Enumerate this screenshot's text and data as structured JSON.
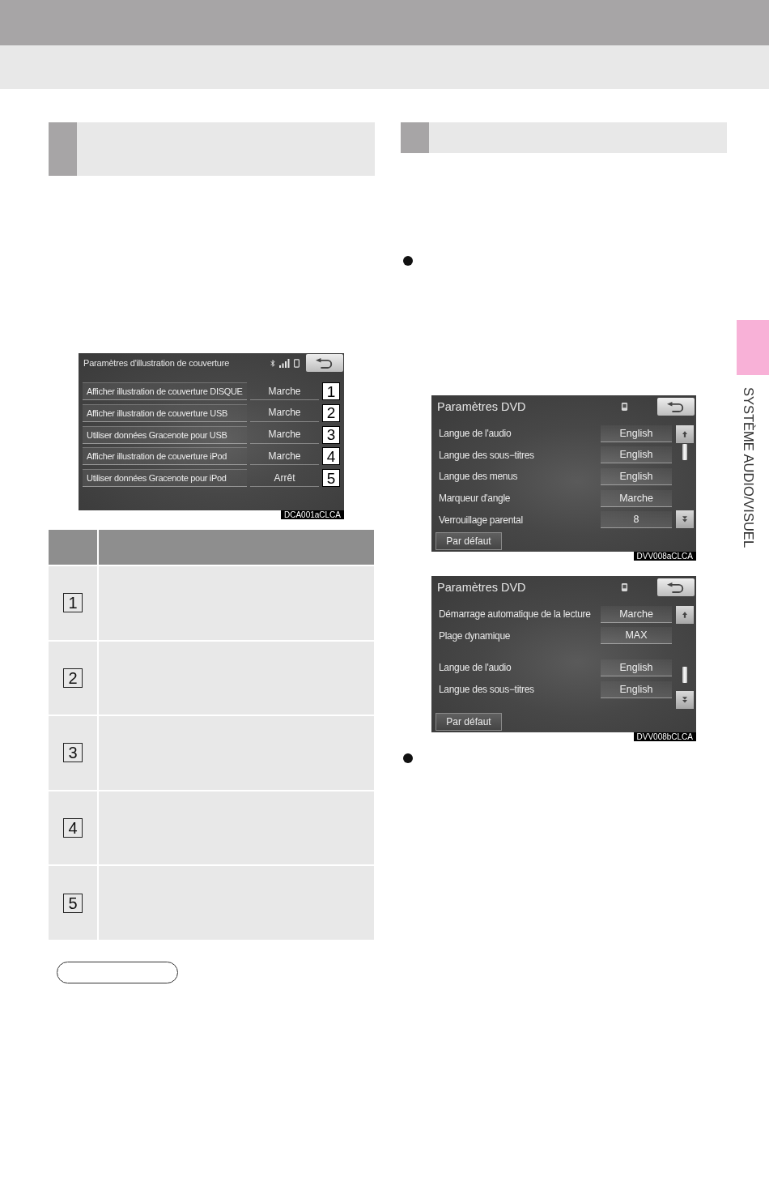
{
  "side_tab": {
    "label": "SYSTÈME AUDIO/VISUEL"
  },
  "cover_art_screen": {
    "title": "Paramètres d'illustration de couverture",
    "rows": [
      {
        "label": "Afficher illustration de couverture DISQUE",
        "value": "Marche",
        "callout": "1"
      },
      {
        "label": "Afficher illustration de couverture USB",
        "value": "Marche",
        "callout": "2"
      },
      {
        "label": "Utiliser données Gracenote pour USB",
        "value": "Marche",
        "callout": "3"
      },
      {
        "label": "Afficher illustration de couverture iPod",
        "value": "Marche",
        "callout": "4"
      },
      {
        "label": "Utiliser données Gracenote pour iPod",
        "value": "Arrêt",
        "callout": "5"
      }
    ],
    "figure_code": "DCA001aCLCA"
  },
  "callout_table": {
    "rows": [
      {
        "callout": "1"
      },
      {
        "callout": "2"
      },
      {
        "callout": "3"
      },
      {
        "callout": "4"
      },
      {
        "callout": "5"
      }
    ]
  },
  "dvd_screens": [
    {
      "title": "Paramètres DVD",
      "row_groups": [
        {
          "rows": [
            {
              "label": "Langue de l'audio",
              "value": "English"
            },
            {
              "label": "Langue des sous−titres",
              "value": "English"
            },
            {
              "label": "Langue des menus",
              "value": "English"
            },
            {
              "label": "Marqueur d'angle",
              "value": "Marche"
            },
            {
              "label": "Verrouillage parental",
              "value": "8"
            }
          ]
        }
      ],
      "default_button": "Par défaut",
      "figure_code": "DVV008aCLCA"
    },
    {
      "title": "Paramètres DVD",
      "row_groups": [
        {
          "rows": [
            {
              "label": "Démarrage automatique de la lecture",
              "value": "Marche"
            },
            {
              "label": "Plage dynamique",
              "value": "MAX"
            }
          ]
        },
        {
          "rows": [
            {
              "label": "Langue de l'audio",
              "value": "English"
            },
            {
              "label": "Langue des sous−titres",
              "value": "English"
            }
          ]
        }
      ],
      "default_button": "Par défaut",
      "figure_code": "DVV008bCLCA"
    }
  ]
}
